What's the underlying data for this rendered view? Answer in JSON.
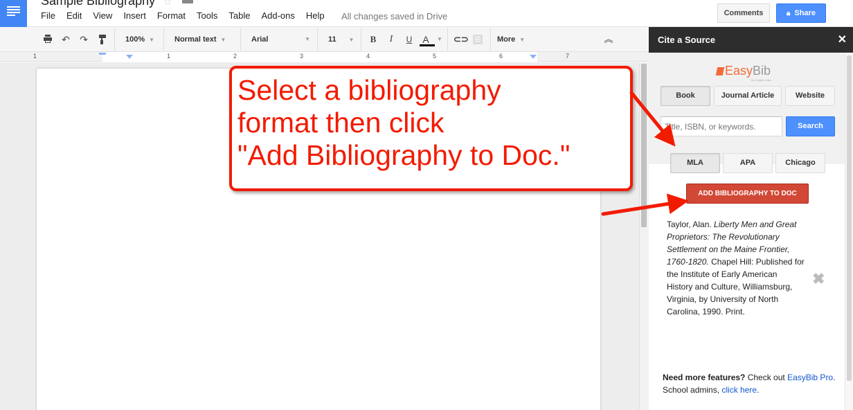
{
  "app": {
    "doc_title": "Sample Bibliography",
    "menu": [
      "File",
      "Edit",
      "View",
      "Insert",
      "Format",
      "Tools",
      "Table",
      "Add-ons",
      "Help"
    ],
    "save_status": "All changes saved in Drive",
    "comments_label": "Comments",
    "share_label": "Share"
  },
  "toolbar": {
    "zoom": "100%",
    "style": "Normal text",
    "font": "Arial",
    "size": "11",
    "bold": "B",
    "italic": "I",
    "underline": "U",
    "text_color": "A",
    "more": "More"
  },
  "ruler": {
    "labels": [
      "1",
      "1",
      "2",
      "3",
      "4",
      "5",
      "6",
      "7"
    ]
  },
  "sidebar": {
    "title": "Cite a Source",
    "logo_main": "Easy",
    "logo_bib": "Bib",
    "logo_sub": "by imagine easy",
    "source_types": [
      {
        "label": "Book",
        "active": true
      },
      {
        "label": "Journal Article",
        "active": false
      },
      {
        "label": "Website",
        "active": false
      }
    ],
    "search_placeholder": "Title, ISBN, or keywords.",
    "search_label": "Search",
    "formats": [
      {
        "label": "MLA",
        "active": true
      },
      {
        "label": "APA",
        "active": false
      },
      {
        "label": "Chicago",
        "active": false
      }
    ],
    "add_bibliography_label": "ADD BIBLIOGRAPHY TO DOC",
    "citation": {
      "author": "Taylor, Alan. ",
      "title": "Liberty Men and Great Proprietors: The Revolutionary Settlement on the Maine Frontier, 1760-1820.",
      "rest": " Chapel Hill: Published for the Institute of Early American History and Culture, Williamsburg, Virginia, by University of North Carolina, 1990. Print."
    },
    "footer": {
      "bold": "Need more features?",
      "text1": " Check out ",
      "link1": "EasyBib Pro",
      "text2": ". School admins, ",
      "link2": "click here",
      "text3": "."
    }
  },
  "annotation": {
    "line1": "Select a bibliography",
    "line2": "format then click",
    "line3": "\"Add Bibliography to Doc.\"",
    "color": "#f21b00"
  },
  "colors": {
    "docs_blue": "#4285f4",
    "share_blue": "#4d90fe",
    "add_red": "#d14836",
    "easybib_orange": "#f26b3a",
    "link_blue": "#1155cc"
  }
}
